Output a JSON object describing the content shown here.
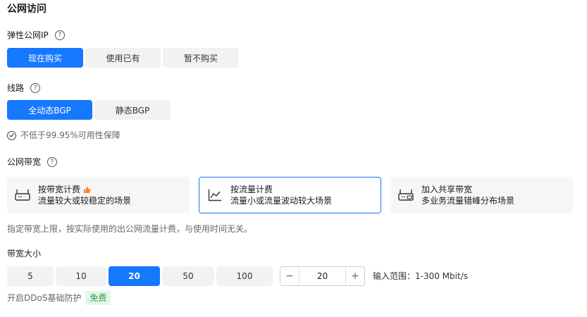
{
  "section_title": "公网访问",
  "eip": {
    "label": "弹性公网IP",
    "options": [
      "现在购买",
      "使用已有",
      "暂不购买"
    ],
    "selected_index": 0
  },
  "line": {
    "label": "线路",
    "options": [
      "全动态BGP",
      "静态BGP"
    ],
    "selected_index": 0,
    "sla_note": "不低于99.95%可用性保障"
  },
  "billing": {
    "label": "公网带宽",
    "cards": [
      {
        "title": "按带宽计费",
        "desc": "流量较大或较稳定的场景",
        "icon": "router-icon",
        "hot": true
      },
      {
        "title": "按流量计费",
        "desc": "流量小或流量波动较大场景",
        "icon": "line-chart-icon",
        "hot": false
      },
      {
        "title": "加入共享带宽",
        "desc": "多业务流量错峰分布场景",
        "icon": "shared-router-icon",
        "hot": false
      }
    ],
    "selected_index": 1,
    "note": "指定带宽上限，按实际使用的出公网流量计费，与使用时间无关。"
  },
  "bandwidth": {
    "label": "带宽大小",
    "options": [
      "5",
      "10",
      "20",
      "50",
      "100"
    ],
    "selected_index": 2,
    "stepper_value": "20",
    "stepper_minus": "−",
    "stepper_plus": "+",
    "range_text": "输入范围：1-300 Mbit/s"
  },
  "ddos": {
    "label": "开启DDoS基础防护",
    "badge": "免费"
  },
  "colors": {
    "accent": "#1677ff",
    "free_badge_bg": "#e3f7e8",
    "free_badge_text": "#2f9e52"
  }
}
